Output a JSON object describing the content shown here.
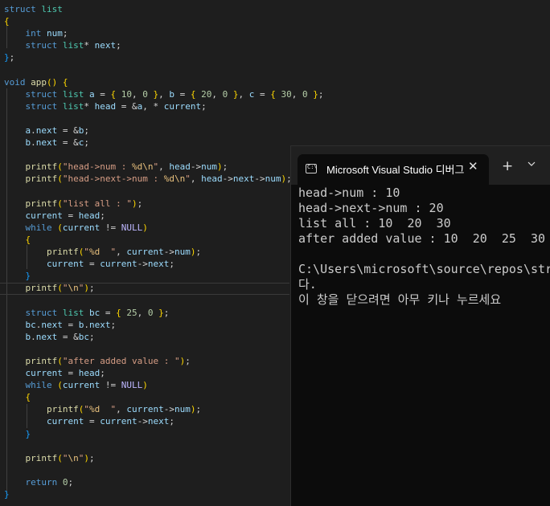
{
  "editor": {
    "lines": [
      [
        "struct list"
      ],
      [
        "{"
      ],
      [
        "    int num;"
      ],
      [
        "    struct list* next;"
      ],
      [
        "};"
      ],
      [
        ""
      ],
      [
        "void app() {"
      ],
      [
        "    struct list a = { 10, 0 }, b = { 20, 0 }, c = { 30, 0 };"
      ],
      [
        "    struct list* head = &a, * current;"
      ],
      [
        ""
      ],
      [
        "    a.next = &b;"
      ],
      [
        "    b.next = &c;"
      ],
      [
        ""
      ],
      [
        "    printf(\"head->num : %d\\n\", head->num);"
      ],
      [
        "    printf(\"head->next->num : %d\\n\", head->next->num);"
      ],
      [
        ""
      ],
      [
        "    printf(\"list all : \");"
      ],
      [
        "    current = head;"
      ],
      [
        "    while (current != NULL)"
      ],
      [
        "    {"
      ],
      [
        "        printf(\"%d  \", current->num);"
      ],
      [
        "        current = current->next;"
      ],
      [
        "    }"
      ],
      [
        "    printf(\"\\n\");"
      ],
      [
        ""
      ],
      [
        "    struct list bc = { 25, 0 };"
      ],
      [
        "    bc.next = b.next;"
      ],
      [
        "    b.next = &bc;"
      ],
      [
        ""
      ],
      [
        "    printf(\"after added value : \");"
      ],
      [
        "    current = head;"
      ],
      [
        "    while (current != NULL)"
      ],
      [
        "    {"
      ],
      [
        "        printf(\"%d  \", current->num);"
      ],
      [
        "        current = current->next;"
      ],
      [
        "    }"
      ],
      [
        ""
      ],
      [
        "    printf(\"\\n\");"
      ],
      [
        ""
      ],
      [
        "    return 0;"
      ],
      [
        "}"
      ]
    ]
  },
  "terminal": {
    "tab_title": "Microsoft Visual Studio 디버그",
    "tab_icon_text": "C:\\",
    "close_glyph": "✕",
    "new_tab_glyph": "+",
    "dropdown_icon": "chevron-down-icon",
    "output": [
      "head->num : 10",
      "head->next->num : 20",
      "list all : 10  20  30",
      "after added value : 10  20  25  30",
      "",
      "C:\\Users\\microsoft\\source\\repos\\str",
      "다.",
      "이 창을 닫으려면 아무 키나 누르세요"
    ]
  },
  "colors": {
    "editor_bg": "#1e1e1e",
    "keyword": "#569cd6",
    "type": "#4ec9b0",
    "function": "#dcdcaa",
    "variable": "#9cdcfe",
    "number": "#b5cea8",
    "string": "#d69d85",
    "terminal_bg": "#0c0c0c",
    "terminal_fg": "#cccccc"
  }
}
